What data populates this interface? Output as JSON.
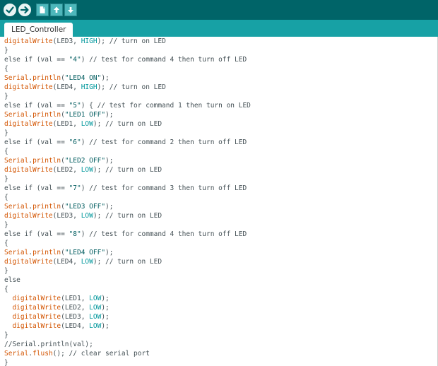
{
  "toolbar": {
    "buttons": [
      {
        "name": "verify",
        "icon": "check-icon"
      },
      {
        "name": "upload",
        "icon": "arrow-right-icon"
      },
      {
        "name": "new",
        "icon": "new-file-icon"
      },
      {
        "name": "open",
        "icon": "open-arrow-up-icon"
      },
      {
        "name": "save",
        "icon": "save-arrow-down-icon"
      }
    ]
  },
  "tabs": [
    {
      "label": "LED_Controller"
    }
  ],
  "colors": {
    "toolbar": "#006468",
    "tabbar": "#17a1a5",
    "function": "#d35400",
    "constant": "#00979c"
  },
  "code_lines": [
    [
      [
        "fn",
        "digitalWrite"
      ],
      [
        "t",
        "(LED3, "
      ],
      [
        "kw",
        "HIGH"
      ],
      [
        "t",
        "); // turn on LED"
      ]
    ],
    [
      [
        "t",
        "}"
      ]
    ],
    [
      [
        "t",
        "else if (val == "
      ],
      [
        "str",
        "\"4\""
      ],
      [
        "t",
        ") // test for command 4 then turn off LED"
      ]
    ],
    [
      [
        "t",
        "{"
      ]
    ],
    [
      [
        "fn",
        "Serial"
      ],
      [
        "t",
        "."
      ],
      [
        "fn",
        "println"
      ],
      [
        "t",
        "("
      ],
      [
        "str",
        "\"LED4 ON\""
      ],
      [
        "t",
        ");"
      ]
    ],
    [
      [
        "fn",
        "digitalWrite"
      ],
      [
        "t",
        "(LED4, "
      ],
      [
        "kw",
        "HIGH"
      ],
      [
        "t",
        "); // turn on LED"
      ]
    ],
    [
      [
        "t",
        "}"
      ]
    ],
    [
      [
        "t",
        "else if (val == "
      ],
      [
        "str",
        "\"5\""
      ],
      [
        "t",
        ") { // test for command 1 then turn on LED"
      ]
    ],
    [
      [
        "fn",
        "Serial"
      ],
      [
        "t",
        "."
      ],
      [
        "fn",
        "println"
      ],
      [
        "t",
        "("
      ],
      [
        "str",
        "\"LED1 OFF\""
      ],
      [
        "t",
        ");"
      ]
    ],
    [
      [
        "fn",
        "digitalWrite"
      ],
      [
        "t",
        "(LED1, "
      ],
      [
        "kw",
        "LOW"
      ],
      [
        "t",
        "); // turn on LED"
      ]
    ],
    [
      [
        "t",
        "}"
      ]
    ],
    [
      [
        "t",
        "else if (val == "
      ],
      [
        "str",
        "\"6\""
      ],
      [
        "t",
        ") // test for command 2 then turn off LED"
      ]
    ],
    [
      [
        "t",
        "{"
      ]
    ],
    [
      [
        "fn",
        "Serial"
      ],
      [
        "t",
        "."
      ],
      [
        "fn",
        "println"
      ],
      [
        "t",
        "("
      ],
      [
        "str",
        "\"LED2 OFF\""
      ],
      [
        "t",
        ");"
      ]
    ],
    [
      [
        "fn",
        "digitalWrite"
      ],
      [
        "t",
        "(LED2, "
      ],
      [
        "kw",
        "LOW"
      ],
      [
        "t",
        "); // turn on LED"
      ]
    ],
    [
      [
        "t",
        "}"
      ]
    ],
    [
      [
        "t",
        "else if (val == "
      ],
      [
        "str",
        "\"7\""
      ],
      [
        "t",
        ") // test for command 3 then turn off LED"
      ]
    ],
    [
      [
        "t",
        "{"
      ]
    ],
    [
      [
        "fn",
        "Serial"
      ],
      [
        "t",
        "."
      ],
      [
        "fn",
        "println"
      ],
      [
        "t",
        "("
      ],
      [
        "str",
        "\"LED3 OFF\""
      ],
      [
        "t",
        ");"
      ]
    ],
    [
      [
        "fn",
        "digitalWrite"
      ],
      [
        "t",
        "(LED3, "
      ],
      [
        "kw",
        "LOW"
      ],
      [
        "t",
        "); // turn on LED"
      ]
    ],
    [
      [
        "t",
        "}"
      ]
    ],
    [
      [
        "t",
        "else if (val == "
      ],
      [
        "str",
        "\"8\""
      ],
      [
        "t",
        ") // test for command 4 then turn off LED"
      ]
    ],
    [
      [
        "t",
        "{"
      ]
    ],
    [
      [
        "fn",
        "Serial"
      ],
      [
        "t",
        "."
      ],
      [
        "fn",
        "println"
      ],
      [
        "t",
        "("
      ],
      [
        "str",
        "\"LED4 OFF\""
      ],
      [
        "t",
        ");"
      ]
    ],
    [
      [
        "fn",
        "digitalWrite"
      ],
      [
        "t",
        "(LED4, "
      ],
      [
        "kw",
        "LOW"
      ],
      [
        "t",
        "); // turn on LED"
      ]
    ],
    [
      [
        "t",
        "}"
      ]
    ],
    [
      [
        "t",
        "else"
      ]
    ],
    [
      [
        "t",
        "{"
      ]
    ],
    [
      [
        "t",
        "  "
      ],
      [
        "fn",
        "digitalWrite"
      ],
      [
        "t",
        "(LED1, "
      ],
      [
        "kw",
        "LOW"
      ],
      [
        "t",
        ");"
      ]
    ],
    [
      [
        "t",
        "  "
      ],
      [
        "fn",
        "digitalWrite"
      ],
      [
        "t",
        "(LED2, "
      ],
      [
        "kw",
        "LOW"
      ],
      [
        "t",
        ");"
      ]
    ],
    [
      [
        "t",
        "  "
      ],
      [
        "fn",
        "digitalWrite"
      ],
      [
        "t",
        "(LED3, "
      ],
      [
        "kw",
        "LOW"
      ],
      [
        "t",
        ");"
      ]
    ],
    [
      [
        "t",
        "  "
      ],
      [
        "fn",
        "digitalWrite"
      ],
      [
        "t",
        "(LED4, "
      ],
      [
        "kw",
        "LOW"
      ],
      [
        "t",
        ");"
      ]
    ],
    [
      [
        "t",
        "}"
      ]
    ],
    [
      [
        "t",
        "//Serial.println(val);"
      ]
    ],
    [
      [
        "fn",
        "Serial"
      ],
      [
        "t",
        "."
      ],
      [
        "fn",
        "flush"
      ],
      [
        "t",
        "(); // clear serial port"
      ]
    ],
    [
      [
        "t",
        "}"
      ]
    ]
  ]
}
